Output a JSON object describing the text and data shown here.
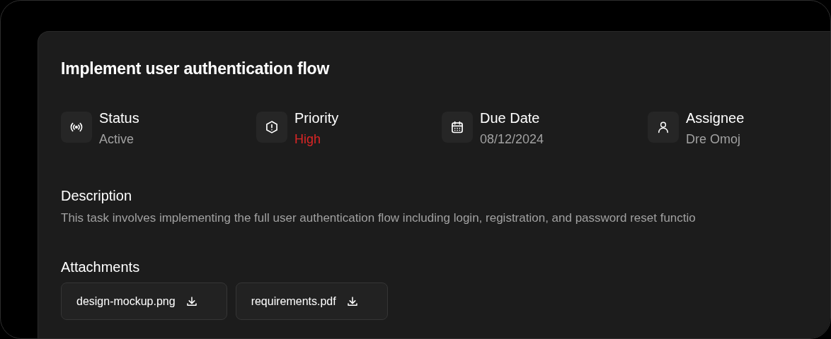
{
  "task": {
    "title": "Implement user authentication flow",
    "fields": [
      {
        "label": "Status",
        "value": "Active",
        "color": "#a1a1a1"
      },
      {
        "label": "Priority",
        "value": "High",
        "color": "#dc2626"
      },
      {
        "label": "Due Date",
        "value": "08/12/2024",
        "color": "#a1a1a1"
      },
      {
        "label": "Assignee",
        "value": "Dre Omoj",
        "color": "#a1a1a1"
      }
    ],
    "description": {
      "heading": "Description",
      "text": "This task involves implementing the full user authentication flow including login, registration, and password reset functio"
    },
    "attachments": {
      "heading": "Attachments",
      "files": [
        "design-mockup.png",
        "requirements.pdf"
      ]
    }
  }
}
